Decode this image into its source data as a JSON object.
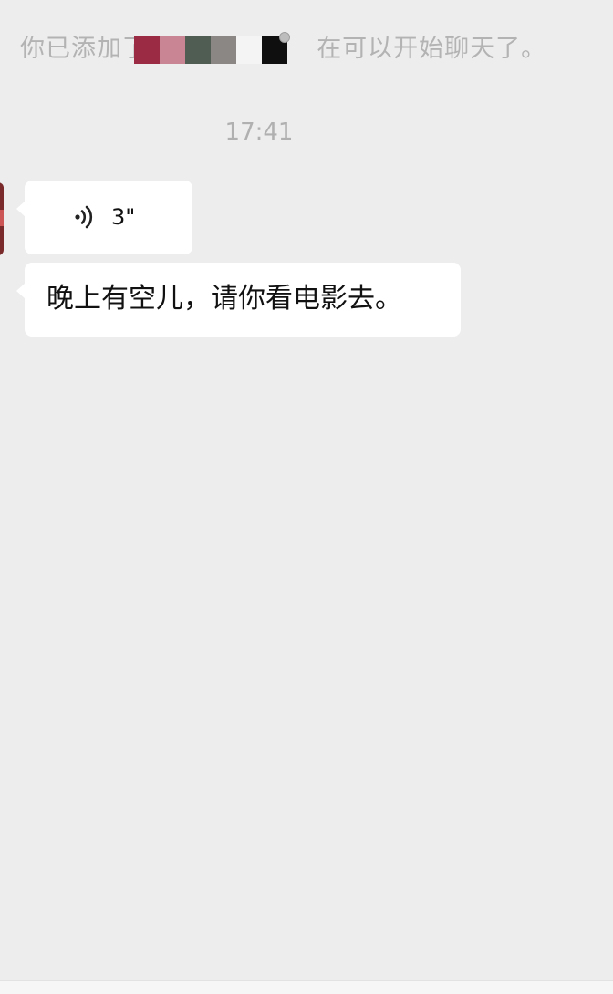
{
  "system_notice": {
    "prefix": "你已添加了",
    "suffix": "在可以开始聊天了。",
    "redaction_colors": [
      "#9b2a44",
      "#c98594",
      "#4f5d52",
      "#8b8784",
      "#f4f4f4",
      "#0f0f0f"
    ]
  },
  "timestamp": "17:41",
  "messages": [
    {
      "type": "voice",
      "duration": "3\"",
      "icon": "voice-wave-icon"
    },
    {
      "type": "text",
      "text": "晚上有空儿，请你看电影去。"
    }
  ],
  "colors": {
    "background": "#ededed",
    "bubble": "#ffffff",
    "system_text": "#b3b3b3"
  }
}
